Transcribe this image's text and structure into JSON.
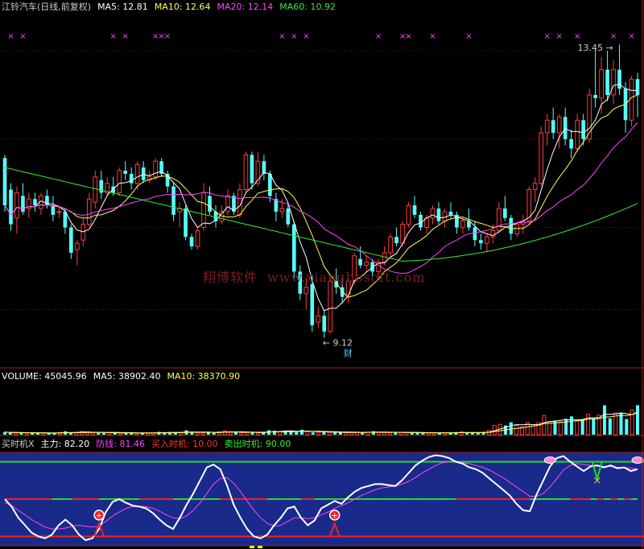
{
  "header": {
    "main": {
      "name": "江铃汽车(日线,前复权)",
      "ma5": "MA5: 12.81",
      "ma10": "MA10: 12.64",
      "ma20": "MA20: 12.14",
      "ma60": "MA60: 10.92"
    },
    "volume": {
      "name": "VOLUME: 45045.96",
      "ma5": "MA5: 38902.40",
      "ma10": "MA10: 38370.90"
    },
    "indicator": {
      "name": "买时机X",
      "main_force": "主力: 82.20",
      "defense": "防线: 81.46",
      "buy": "买入时机: 10.00",
      "sell": "卖出时机: 90.00"
    }
  },
  "annotations": {
    "high": "13.45",
    "low": "9.12",
    "low_mark": "财"
  },
  "watermark": {
    "cn": "翔博软件",
    "url": "www.xiangbosoft.com"
  },
  "colors": {
    "up": "#ff3c3c",
    "down": "#54ffff",
    "ma5": "#ffffff",
    "ma10": "#ffff55",
    "ma20": "#ff44ff",
    "ma60": "#33ee33",
    "panel": "#1a2a8a"
  },
  "chart_data": [
    {
      "type": "candlestick",
      "title": "江铃汽车(日线,前复权)",
      "ylim": [
        8.6,
        14.2
      ],
      "ohlc": [
        [
          11.9,
          11.95,
          11.05,
          11.15
        ],
        [
          11.4,
          11.5,
          10.75,
          10.85
        ],
        [
          10.95,
          11.45,
          10.7,
          11.35
        ],
        [
          11.3,
          11.5,
          11.0,
          11.05
        ],
        [
          11.1,
          11.35,
          10.95,
          11.25
        ],
        [
          11.25,
          11.35,
          11.05,
          11.15
        ],
        [
          11.1,
          11.35,
          11.0,
          11.3
        ],
        [
          11.3,
          11.4,
          11.1,
          11.15
        ],
        [
          11.15,
          11.3,
          10.9,
          11.0
        ],
        [
          11.05,
          11.15,
          10.95,
          11.05
        ],
        [
          11.05,
          11.1,
          10.7,
          10.8
        ],
        [
          10.8,
          10.85,
          10.3,
          10.4
        ],
        [
          10.45,
          10.6,
          10.2,
          10.55
        ],
        [
          10.6,
          10.95,
          10.5,
          10.85
        ],
        [
          10.85,
          11.35,
          10.8,
          11.25
        ],
        [
          11.2,
          11.7,
          11.1,
          11.6
        ],
        [
          11.55,
          11.7,
          11.25,
          11.35
        ],
        [
          11.35,
          11.6,
          11.3,
          11.5
        ],
        [
          11.45,
          11.6,
          11.3,
          11.35
        ],
        [
          11.35,
          11.75,
          11.3,
          11.7
        ],
        [
          11.7,
          11.85,
          11.55,
          11.65
        ],
        [
          11.65,
          11.75,
          11.4,
          11.5
        ],
        [
          11.5,
          11.85,
          11.4,
          11.8
        ],
        [
          11.75,
          11.85,
          11.5,
          11.55
        ],
        [
          11.55,
          11.7,
          11.5,
          11.6
        ],
        [
          11.6,
          11.9,
          11.55,
          11.85
        ],
        [
          11.85,
          11.9,
          11.6,
          11.65
        ],
        [
          11.65,
          11.7,
          11.35,
          11.45
        ],
        [
          11.45,
          11.5,
          10.9,
          11.0
        ],
        [
          11.05,
          11.2,
          10.8,
          11.1
        ],
        [
          11.1,
          11.15,
          10.6,
          10.65
        ],
        [
          10.65,
          10.7,
          10.45,
          10.5
        ],
        [
          10.5,
          10.8,
          10.45,
          10.75
        ],
        [
          10.8,
          11.5,
          10.75,
          11.35
        ],
        [
          11.3,
          11.45,
          11.0,
          11.05
        ],
        [
          11.05,
          11.15,
          10.8,
          10.9
        ],
        [
          10.9,
          11.15,
          10.85,
          11.05
        ],
        [
          11.05,
          11.4,
          11.0,
          11.3
        ],
        [
          11.3,
          11.35,
          11.0,
          11.05
        ],
        [
          11.0,
          11.5,
          10.95,
          11.4
        ],
        [
          11.4,
          12.0,
          11.35,
          11.95
        ],
        [
          11.95,
          12.0,
          11.4,
          11.5
        ],
        [
          11.5,
          12.0,
          11.45,
          11.85
        ],
        [
          11.85,
          11.95,
          11.55,
          11.65
        ],
        [
          11.65,
          11.7,
          11.2,
          11.3
        ],
        [
          11.25,
          11.35,
          10.9,
          11.05
        ],
        [
          11.05,
          11.25,
          10.95,
          11.1
        ],
        [
          11.1,
          11.2,
          10.8,
          10.85
        ],
        [
          10.85,
          10.9,
          10.0,
          10.1
        ],
        [
          10.1,
          10.2,
          9.65,
          9.75
        ],
        [
          9.75,
          10.0,
          9.5,
          9.85
        ],
        [
          9.9,
          10.05,
          9.15,
          9.25
        ],
        [
          9.3,
          9.55,
          9.2,
          9.4
        ],
        [
          9.4,
          9.5,
          9.05,
          9.15
        ],
        [
          9.15,
          10.0,
          9.12,
          9.95
        ],
        [
          9.95,
          10.15,
          9.75,
          9.85
        ],
        [
          9.85,
          10.0,
          9.6,
          9.7
        ],
        [
          9.7,
          10.0,
          9.6,
          9.95
        ],
        [
          9.95,
          10.4,
          9.9,
          10.35
        ],
        [
          10.3,
          10.5,
          10.15,
          10.2
        ],
        [
          10.2,
          10.35,
          10.1,
          10.25
        ],
        [
          10.25,
          10.3,
          10.0,
          10.1
        ],
        [
          10.1,
          10.3,
          10.0,
          10.25
        ],
        [
          10.25,
          10.5,
          10.2,
          10.4
        ],
        [
          10.4,
          10.7,
          10.3,
          10.65
        ],
        [
          10.65,
          10.8,
          10.5,
          10.55
        ],
        [
          10.55,
          10.9,
          10.5,
          10.85
        ],
        [
          10.85,
          11.2,
          10.8,
          11.15
        ],
        [
          11.15,
          11.3,
          10.95,
          11.0
        ],
        [
          11.0,
          11.05,
          10.75,
          10.8
        ],
        [
          10.8,
          11.0,
          10.7,
          10.95
        ],
        [
          10.95,
          11.15,
          10.85,
          11.1
        ],
        [
          11.1,
          11.2,
          10.85,
          10.9
        ],
        [
          10.9,
          11.1,
          10.8,
          11.05
        ],
        [
          11.05,
          11.2,
          10.95,
          11.0
        ],
        [
          11.0,
          11.05,
          10.7,
          10.8
        ],
        [
          10.8,
          10.95,
          10.7,
          10.9
        ],
        [
          10.9,
          11.1,
          10.75,
          10.8
        ],
        [
          10.8,
          10.9,
          10.5,
          10.6
        ],
        [
          10.6,
          10.7,
          10.45,
          10.55
        ],
        [
          10.55,
          10.7,
          10.4,
          10.65
        ],
        [
          10.65,
          10.85,
          10.55,
          10.75
        ],
        [
          10.75,
          11.2,
          10.7,
          11.1
        ],
        [
          11.1,
          11.3,
          10.9,
          10.95
        ],
        [
          10.95,
          11.0,
          10.6,
          10.7
        ],
        [
          10.7,
          10.9,
          10.65,
          10.85
        ],
        [
          10.85,
          11.0,
          10.7,
          10.9
        ],
        [
          10.9,
          11.45,
          10.85,
          11.4
        ],
        [
          11.4,
          11.6,
          11.2,
          11.5
        ],
        [
          11.5,
          12.4,
          11.45,
          12.3
        ],
        [
          12.3,
          12.6,
          12.1,
          12.5
        ],
        [
          12.5,
          12.7,
          12.2,
          12.3
        ],
        [
          12.3,
          12.6,
          12.05,
          12.55
        ],
        [
          12.55,
          12.7,
          12.1,
          12.2
        ],
        [
          12.2,
          12.35,
          11.9,
          12.05
        ],
        [
          12.05,
          12.6,
          12.0,
          12.5
        ],
        [
          12.5,
          12.6,
          12.1,
          12.2
        ],
        [
          12.2,
          13.0,
          12.15,
          12.9
        ],
        [
          12.9,
          13.6,
          12.7,
          12.85
        ],
        [
          12.85,
          13.5,
          12.6,
          13.3
        ],
        [
          13.3,
          13.6,
          12.8,
          12.9
        ],
        [
          12.9,
          13.45,
          12.75,
          13.3
        ],
        [
          13.3,
          13.7,
          12.9,
          13.0
        ],
        [
          13.0,
          13.1,
          12.3,
          12.5
        ],
        [
          12.5,
          13.2,
          12.4,
          13.15
        ],
        [
          13.15,
          13.25,
          12.55,
          12.9
        ]
      ]
    },
    {
      "type": "bar",
      "title": "VOLUME",
      "ylim": [
        0,
        80000
      ],
      "values": [
        4000,
        3000,
        2800,
        3200,
        2500,
        2700,
        2600,
        2400,
        2600,
        2200,
        3400,
        5200,
        3000,
        3600,
        4800,
        4300,
        3000,
        2800,
        2600,
        3400,
        2800,
        2500,
        2700,
        2500,
        2300,
        3100,
        2600,
        2700,
        4300,
        3400,
        3900,
        3400,
        3100,
        6600,
        4000,
        3000,
        2800,
        3500,
        2600,
        4300,
        5900,
        4600,
        4400,
        3000,
        3300,
        3600,
        2800,
        3600,
        6800,
        6000,
        4900,
        6300,
        5200,
        4000,
        7600,
        4600,
        3500,
        3900,
        4700,
        3800,
        3000,
        3100,
        3100,
        3400,
        4100,
        3600,
        3900,
        5300,
        3500,
        3300,
        3000,
        3300,
        3700,
        3100,
        3100,
        2900,
        2700,
        2700,
        2900,
        2400,
        2600,
        3000,
        4000,
        4300,
        3500,
        2700,
        2700,
        4000,
        6500,
        14000,
        15800,
        14200,
        19100,
        14000,
        12000,
        18600,
        13200,
        18300,
        29300,
        20300,
        21700,
        19800,
        24200,
        28000,
        20800,
        23600,
        31000,
        25000,
        30000,
        45000,
        25000,
        33000,
        33500,
        24000,
        38000,
        45046
      ]
    },
    {
      "type": "line",
      "title": "买时机X",
      "ylim": [
        0,
        100
      ],
      "series": [
        {
          "name": "主力",
          "values": [
            50,
            42,
            30,
            22,
            14,
            10,
            8,
            12,
            22,
            28,
            22,
            12,
            6,
            8,
            18,
            36,
            47,
            50,
            46,
            43,
            42,
            40,
            35,
            28,
            22,
            18,
            30,
            44,
            56,
            70,
            84,
            87,
            82,
            65,
            44,
            30,
            18,
            10,
            8,
            12,
            22,
            30,
            40,
            42,
            30,
            22,
            27,
            40,
            44,
            48,
            45,
            52,
            58,
            62,
            64,
            66,
            66,
            65,
            64,
            70,
            78,
            86,
            91,
            95,
            97,
            96,
            94,
            90,
            88,
            84,
            82,
            78,
            72,
            66,
            60,
            54,
            45,
            38,
            37,
            55,
            70,
            85,
            94,
            96,
            90,
            85,
            80,
            85,
            86,
            84,
            86,
            83,
            84,
            80,
            82
          ]
        },
        {
          "name": "防线",
          "values": [
            46,
            43,
            38,
            33,
            28,
            24,
            20,
            18,
            18,
            19,
            21,
            22,
            21,
            20,
            21,
            26,
            32,
            36,
            40,
            42,
            42,
            42,
            40,
            37,
            33,
            30,
            29,
            32,
            38,
            46,
            56,
            66,
            72,
            73,
            67,
            58,
            48,
            38,
            30,
            24,
            21,
            22,
            26,
            30,
            30,
            29,
            30,
            33,
            36,
            40,
            43,
            46,
            50,
            54,
            57,
            60,
            62,
            63,
            64,
            66,
            69,
            73,
            78,
            82,
            86,
            89,
            90,
            90,
            89,
            88,
            86,
            84,
            81,
            77,
            73,
            68,
            63,
            58,
            53,
            53,
            56,
            63,
            72,
            81,
            86,
            88,
            87,
            86,
            86,
            85,
            85,
            84,
            84,
            83,
            82
          ]
        },
        {
          "name": "买入时机",
          "values": [
            10,
            10
          ]
        },
        {
          "name": "卖出时机",
          "values": [
            90,
            90
          ]
        }
      ]
    }
  ]
}
